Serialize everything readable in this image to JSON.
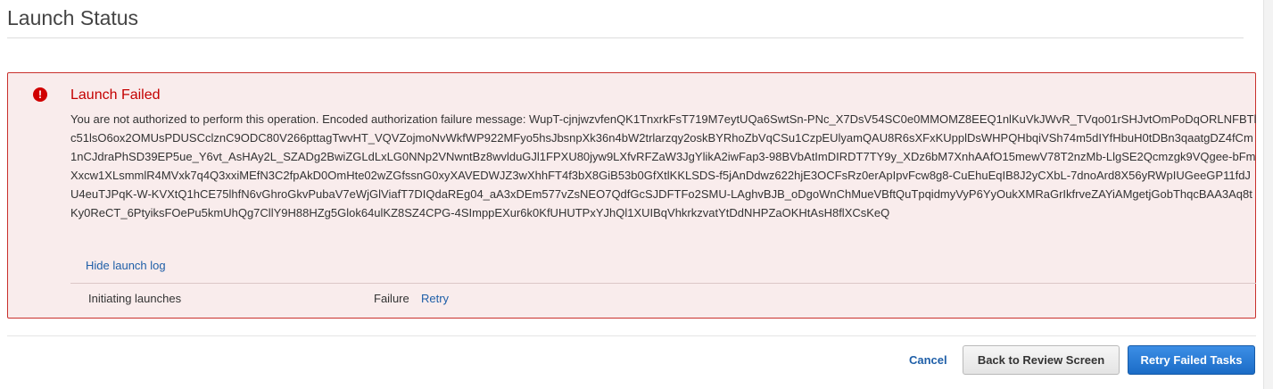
{
  "header": {
    "title": "Launch Status"
  },
  "error": {
    "icon": "exclamation-circle-icon",
    "title": "Launch Failed",
    "message": "You are not authorized to perform this operation. Encoded authorization failure message: WupT-cjnjwzvfenQK1TnxrkFsT719M7eytUQa6SwtSn-PNc_X7DsV54SC0e0MMOMZ8EEQ1nlKuVkJWvR_TVqo01rSHJvtOmPoDqORLNFBTlc51lsO6ox2OMUsPDUSCclznC9ODC80V266pttagTwvHT_VQVZojmoNvWkfWP922MFyo5hsJbsnpXk36n4bW2trlarzqy2oskBYRhoZbVqCSu1CzpEUlyamQAU8R6sXFxKUpplDsWHPQHbqiVSh74m5dIYfHbuH0tDBn3qaatgDZ4fCm1nCJdraPhSD39EP5ue_Y6vt_AsHAy2L_SZADg2BwiZGLdLxLG0NNp2VNwntBz8wvlduGJl1FPXU80jyw9LXfvRFZaW3JgYlikA2iwFap3-98BVbAtImDIRDT7TY9y_XDz6bM7XnhAAfO15mewV78T2nzMb-LlgSE2Qcmzgk9VQgee-bFmXxcw1XLsmmlR4MVxk7q4Q3xxiMEfN3C2fpAkD0OmHte02wZGfssnG0xyXAVEDWJZ3wXhhFT4f3bX8GiB53b0GfXtlKKLSDS-f5jAnDdwz622hjE3OCFsRz0erApIpvFcw8g8-CuEhuEqIB8J2yCXbL-7dnoArd8X56yRWpIUGeeGP11fdJU4euTJPqK-W-KVXtQ1hCE75lhfN6vGhroGkvPubaV7eWjGlViafT7DIQdaREg04_aA3xDEm577vZsNEO7QdfGcSJDFTFo2SMU-LAghvBJB_oDgoWnChMueVBftQuTpqidmyVyP6YyOukXMRaGrIkfrveZAYiAMgetjGobThqcBAA3Aq8tKy0ReCT_6PtyiksFOePu5kmUhQg7CllY9H88HZg5Glok64ulKZ8SZ4CPG-4SImppEXur6k0KfUHUTPxYJhQl1XUIBqVhkrkzvatYtDdNHPZaOKHtAsH8flXCsKeQ",
    "hide_log_label": "Hide launch log"
  },
  "tasks": [
    {
      "name": "Initiating launches",
      "status": "Failure",
      "action_label": "Retry"
    }
  ],
  "footer": {
    "cancel_label": "Cancel",
    "back_label": "Back to Review Screen",
    "retry_failed_label": "Retry Failed Tasks"
  },
  "colors": {
    "error_border": "#c9302c",
    "error_background": "#f9ecec",
    "error_title": "#c40000",
    "link": "#1f5fa8",
    "primary_button": "#2f7fd8"
  }
}
